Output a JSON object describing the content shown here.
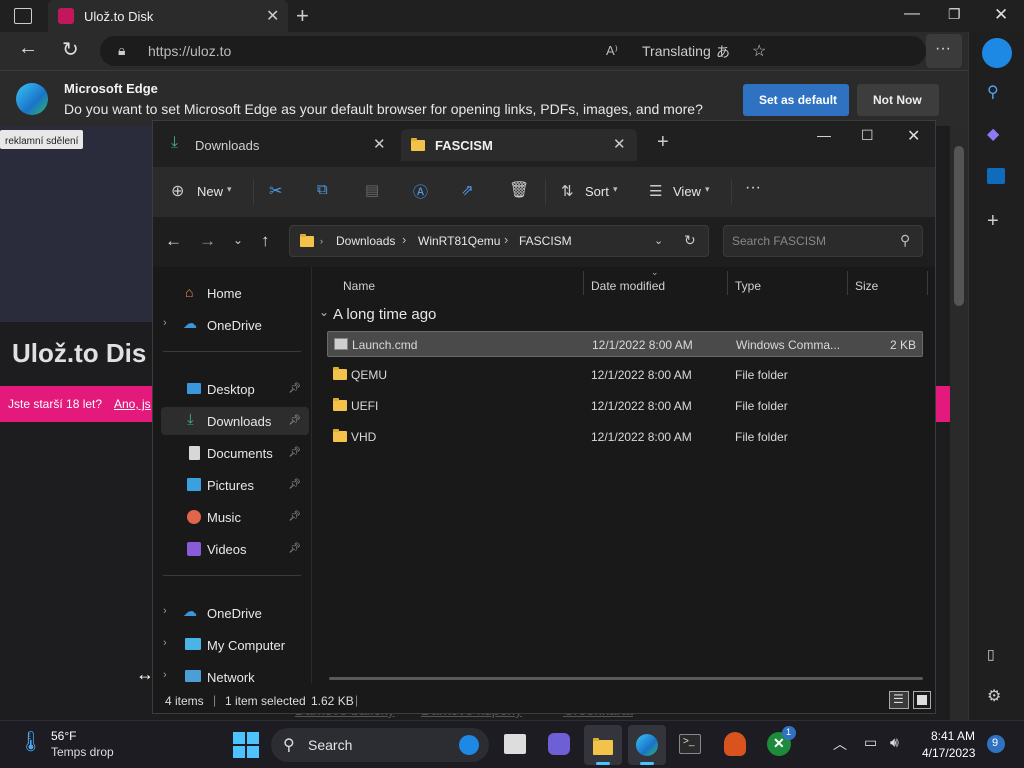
{
  "browser": {
    "tab_title": "Ulož.to Disk",
    "url": "https://uloz.to",
    "translating": "Translating",
    "infobar": {
      "title": "Microsoft Edge",
      "message": "Do you want to set Microsoft Edge as your default browser for opening links, PDFs, images, and more?",
      "set_default": "Set as default",
      "not_now": "Not Now"
    }
  },
  "webpage": {
    "ad_label": "reklamní sdělení",
    "logo": "Ulož.to Dis",
    "age_prompt": "Jste starší 18 let?",
    "age_link": "Ano, js",
    "footer_links": [
      "Dárkové balíčky",
      "Dárkové kupóny",
      "Greenkarta"
    ]
  },
  "explorer": {
    "tabs": [
      {
        "label": "Downloads",
        "icon": "download-icon"
      },
      {
        "label": "FASCISM",
        "icon": "folder-icon"
      }
    ],
    "toolbar": {
      "new": "New",
      "sort": "Sort",
      "view": "View"
    },
    "breadcrumb": [
      "Downloads",
      "WinRT81Qemu",
      "FASCISM"
    ],
    "search_placeholder": "Search FASCISM",
    "nav": {
      "home": "Home",
      "onedrive": "OneDrive",
      "desktop": "Desktop",
      "downloads": "Downloads",
      "documents": "Documents",
      "pictures": "Pictures",
      "music": "Music",
      "videos": "Videos",
      "onedrive2": "OneDrive",
      "mycomputer": "My Computer",
      "network": "Network"
    },
    "columns": {
      "name": "Name",
      "date": "Date modified",
      "type": "Type",
      "size": "Size"
    },
    "group": "A long time ago",
    "files": [
      {
        "name": "Launch.cmd",
        "date": "12/1/2022 8:00 AM",
        "type": "Windows Comma...",
        "size": "2 KB",
        "selected": true,
        "kind": "cmd"
      },
      {
        "name": "QEMU",
        "date": "12/1/2022 8:00 AM",
        "type": "File folder",
        "size": "",
        "selected": false,
        "kind": "folder"
      },
      {
        "name": "UEFI",
        "date": "12/1/2022 8:00 AM",
        "type": "File folder",
        "size": "",
        "selected": false,
        "kind": "folder"
      },
      {
        "name": "VHD",
        "date": "12/1/2022 8:00 AM",
        "type": "File folder",
        "size": "",
        "selected": false,
        "kind": "folder"
      }
    ],
    "status": {
      "items": "4 items",
      "selected": "1 item selected",
      "size": "1.62 KB"
    }
  },
  "taskbar": {
    "weather_temp": "56°F",
    "weather_desc": "Temps drop",
    "search": "Search",
    "time": "8:41 AM",
    "date": "4/17/2023",
    "notifications": "9",
    "xbox_badge": "1"
  },
  "colors": {
    "accent": "#2f72c2",
    "pink": "#e4197c",
    "folder": "#f2c24a",
    "selected_row": "#4a4a4a"
  }
}
